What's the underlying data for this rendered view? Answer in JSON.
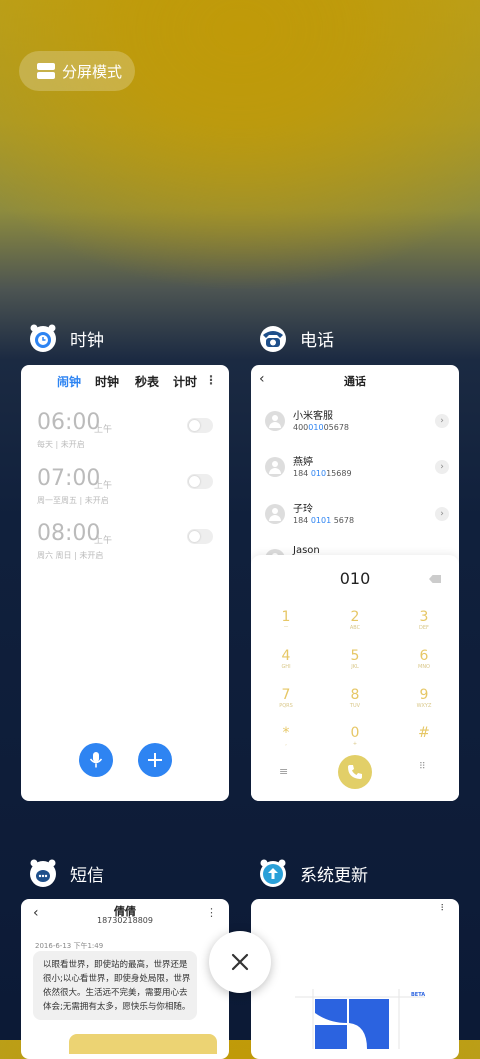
{
  "split_mode": {
    "label": "分屏模式"
  },
  "apps": {
    "clock": {
      "name": "时钟",
      "tabs": [
        "闹钟",
        "时钟",
        "秒表",
        "计时"
      ],
      "alarms": [
        {
          "time": "06:00",
          "period": "上午",
          "detail": "每天 | 未开启"
        },
        {
          "time": "07:00",
          "period": "上午",
          "detail": "周一至周五 | 未开启"
        },
        {
          "time": "08:00",
          "period": "上午",
          "detail": "周六 周日 | 未开启"
        }
      ]
    },
    "phone": {
      "name": "电话",
      "title": "通话",
      "contacts": [
        {
          "name": "小米客服",
          "pre": "400",
          "hl": "010",
          "post": "05678"
        },
        {
          "name": "燕婷",
          "pre": "184 ",
          "hl": "010",
          "post": "15689"
        },
        {
          "name": "子玲",
          "pre": "184 ",
          "hl": "0101",
          "post": " 5678"
        },
        {
          "name": "Jason",
          "pre": "",
          "hl": "",
          "post": ""
        }
      ],
      "dial_input": "010",
      "keys": [
        {
          "d": "1",
          "l": "ㅡ"
        },
        {
          "d": "2",
          "l": "ABC"
        },
        {
          "d": "3",
          "l": "DEF"
        },
        {
          "d": "4",
          "l": "GHI"
        },
        {
          "d": "5",
          "l": "JKL"
        },
        {
          "d": "6",
          "l": "MNO"
        },
        {
          "d": "7",
          "l": "PQRS"
        },
        {
          "d": "8",
          "l": "TUV"
        },
        {
          "d": "9",
          "l": "WXYZ"
        },
        {
          "d": "*",
          "l": ","
        },
        {
          "d": "0",
          "l": "+"
        },
        {
          "d": "#",
          "l": ""
        }
      ]
    },
    "sms": {
      "name": "短信",
      "contact_name": "倩倩",
      "contact_number": "18730218809",
      "timestamp": "2016-6-13 下午1:49",
      "message": "以眼看世界，即使站的最高，世界还是很小;以心看世界，即使身处局限，世界依然很大。生活远不完美，需要用心去体会;无需拥有太多，愿快乐与你相随。"
    },
    "update": {
      "name": "系统更新",
      "badge": "BETA"
    }
  },
  "colors": {
    "accent_blue": "#2e84f2",
    "dial_yellow": "#e2cf68"
  }
}
